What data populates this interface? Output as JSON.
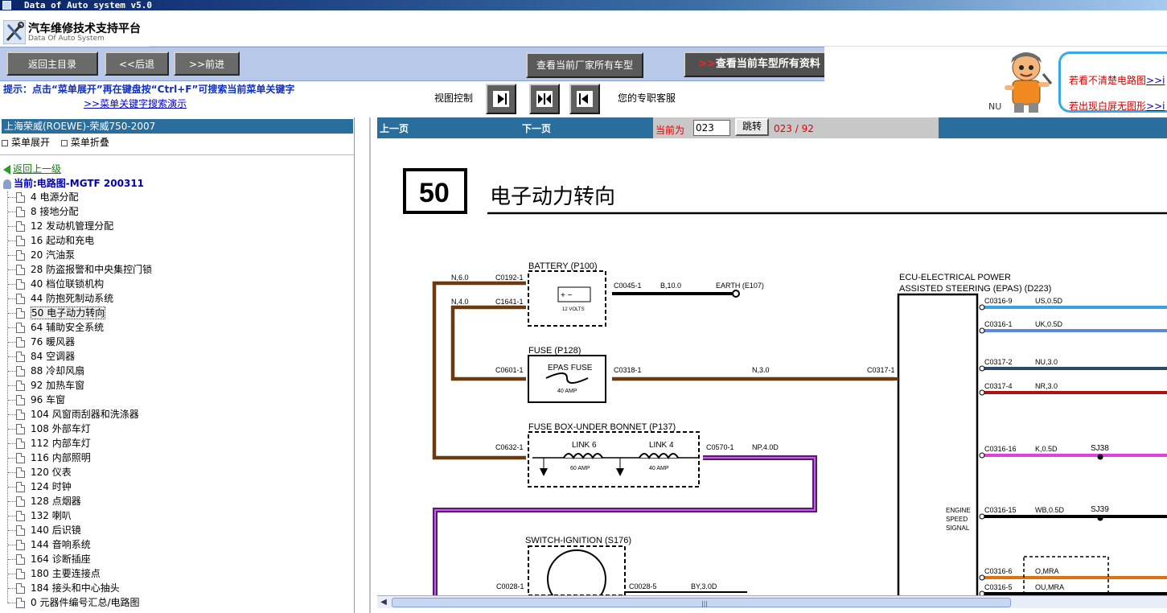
{
  "window": {
    "title": "Data of Auto system v5.0"
  },
  "brand": {
    "title": "汽车维修技术支持平台",
    "subtitle": "Data Of Auto System"
  },
  "toolbar": {
    "back_home": "返回主目录",
    "back": "<<后退",
    "forward": ">>前进",
    "view_maker_models": "查看当前厂家所有车型",
    "view_model_all_prefix": ">>",
    "view_model_all": "查看当前车型所有资料"
  },
  "help": {
    "line1_text": "若看不清楚电路图",
    "line1_link": ">>i",
    "line2_text": "若出现白屏无图形",
    "line2_link": ">>i",
    "nu": "NU"
  },
  "hint": {
    "text": "提示：点击“菜单展开”再在键盘按“Ctrl+F”可搜索当前菜单关键字",
    "link": ">>菜单关键字搜索演示",
    "view_control": "视图控制",
    "service": "您的专职客服"
  },
  "sidebar": {
    "title": "上海荣威(ROEWE)-荣威750-2007",
    "expand": "菜单展开",
    "collapse": "菜单折叠",
    "back_up": "返回上一级",
    "current": "当前:电路图-MGTF 200311",
    "items": [
      "4 电源分配",
      "8 接地分配",
      "12 发动机管理分配",
      "16 起动和充电",
      "20 汽油泵",
      "28 防盗报警和中央集控门锁",
      "40 档位联锁机构",
      "44 防抱死制动系统",
      "50 电子动力转向",
      "64 辅助安全系统",
      "76 暖风器",
      "84 空调器",
      "88 冷却风扇",
      "92 加热车窗",
      "96 车窗",
      "104 风窗雨刮器和洗涤器",
      "108 外部车灯",
      "112 内部车灯",
      "116 内部照明",
      "120 仪表",
      "124 时钟",
      "128 点烟器",
      "132 喇叭",
      "140 后识镜",
      "144 音响系统",
      "164 诊断插座",
      "180 主要连接点",
      "184 接头和中心抽头",
      "0 元器件编号汇总/电路图"
    ],
    "selected_index": 8
  },
  "nav": {
    "prev": "上一页",
    "next": "下一页",
    "current_label": "当前为",
    "page_input": "023",
    "go": "跳转",
    "pages": "023 / 92"
  },
  "diagram": {
    "section_number": "50",
    "section_title": "电子动力转向",
    "battery_label": "BATTERY (P100)",
    "battery_volts": "12 VOLTS",
    "fuse_label": "FUSE (P128)",
    "fuse_name": "EPAS FUSE",
    "fuse_amp": "40 AMP",
    "fusebox_label": "FUSE BOX-UNDER BONNET (P137)",
    "link6": "LINK 6",
    "link6_amp": "60 AMP",
    "link4": "LINK 4",
    "link4_amp": "40 AMP",
    "switch_label": "SWITCH-IGNITION (S176)",
    "ecu_label1": "ECU-ELECTRICAL POWER",
    "ecu_label2": "ASSISTED STEERING (EPAS) (D223)",
    "engine_speed": [
      "ENGINE",
      "SPEED",
      "SIGNAL"
    ],
    "wires": {
      "n60": "N,6.0",
      "n40": "N,4.0",
      "c0192": "C0192-1",
      "c1641": "C1641-1",
      "c0045": "C0045-1",
      "b100": "B,10.0",
      "earth": "EARTH (E107)",
      "c0601": "C0601-1",
      "c0318": "C0318-1",
      "n30": "N,3.0",
      "c0317": "C0317-1",
      "c0632": "C0632-1",
      "c0570": "C0570-1",
      "np40": "NP,4.0D",
      "c0028_1": "C0028-1",
      "c0028_5": "C0028-5",
      "by30": "BY,3.0D"
    },
    "ecu_pins": [
      {
        "pin": "C0316-9",
        "wire": "US,0.5D",
        "color": "#3aa0e8"
      },
      {
        "pin": "C0316-1",
        "wire": "UK,0.5D",
        "color": "#5a8ae0"
      },
      {
        "pin": "C0317-2",
        "wire": "NU,3.0",
        "color": "#2a4a6a"
      },
      {
        "pin": "C0317-4",
        "wire": "NR,3.0",
        "color": "#b01010"
      },
      {
        "pin": "C0316-16",
        "wire": "K,0.5D",
        "color": "#e040e0"
      },
      {
        "pin": "C0316-15",
        "wire": "WB,0.5D",
        "color": "#000000"
      },
      {
        "pin": "C0316-6",
        "wire": "O,MRA",
        "color": "#e07010"
      },
      {
        "pin": "C0316-5",
        "wire": "OU,MRA",
        "color": "#000000"
      }
    ],
    "splices": {
      "sj38": "SJ38",
      "sj39": "SJ39"
    },
    "colors": {
      "brown": "#6b3a10",
      "purple": "#7a2a9a",
      "wire_black": "#000000"
    }
  }
}
